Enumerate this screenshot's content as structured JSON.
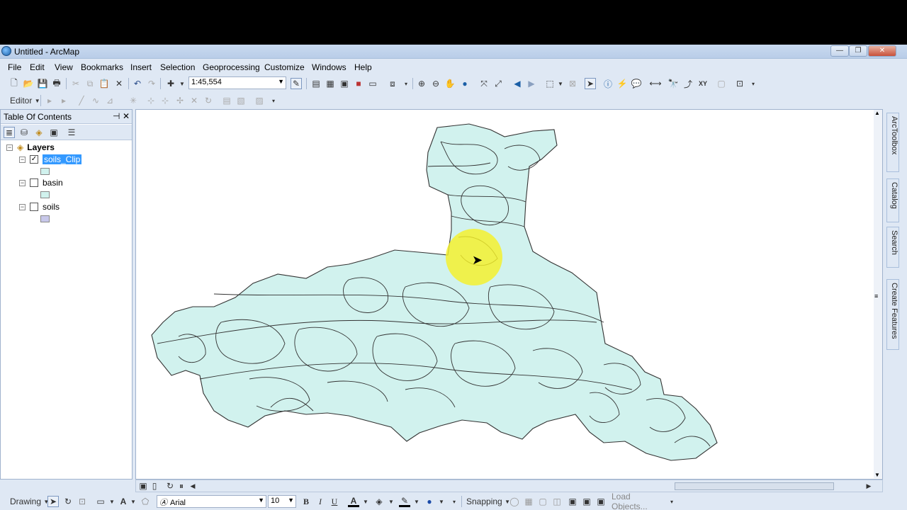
{
  "window": {
    "title": "Untitled - ArcMap",
    "min_label": "—",
    "max_label": "❐",
    "close_label": "✕"
  },
  "menu": [
    "File",
    "Edit",
    "View",
    "Bookmarks",
    "Insert",
    "Selection",
    "Geoprocessing",
    "Customize",
    "Windows",
    "Help"
  ],
  "standard_toolbar": {
    "scale_value": "1:45,554"
  },
  "editor_toolbar": {
    "editor_label": "Editor"
  },
  "toc": {
    "title": "Table Of Contents",
    "pin_label": "⊣",
    "close_label": "✕",
    "root_label": "Layers",
    "layers": [
      {
        "name": "soils_Clip",
        "checked": true,
        "selected": true,
        "swatch_color": "#d1f2ee"
      },
      {
        "name": "basin",
        "checked": false,
        "selected": false,
        "swatch_color": "#d1f2ee"
      },
      {
        "name": "soils",
        "checked": false,
        "selected": false,
        "swatch_color": "#c8c8ea"
      }
    ]
  },
  "map": {
    "fill_color": "#d1f2ee",
    "highlight_color": "#f5f028"
  },
  "side_dock": {
    "tabs": [
      "ArcToolbox",
      "Catalog",
      "Search",
      "Create Features"
    ]
  },
  "drawing_toolbar": {
    "drawing_label": "Drawing",
    "font_name": "Arial",
    "font_size": "10",
    "bold": "B",
    "italic": "I",
    "underline": "U",
    "text_tool": "A",
    "snapping_label": "Snapping",
    "load_objects_label": "Load Objects..."
  }
}
